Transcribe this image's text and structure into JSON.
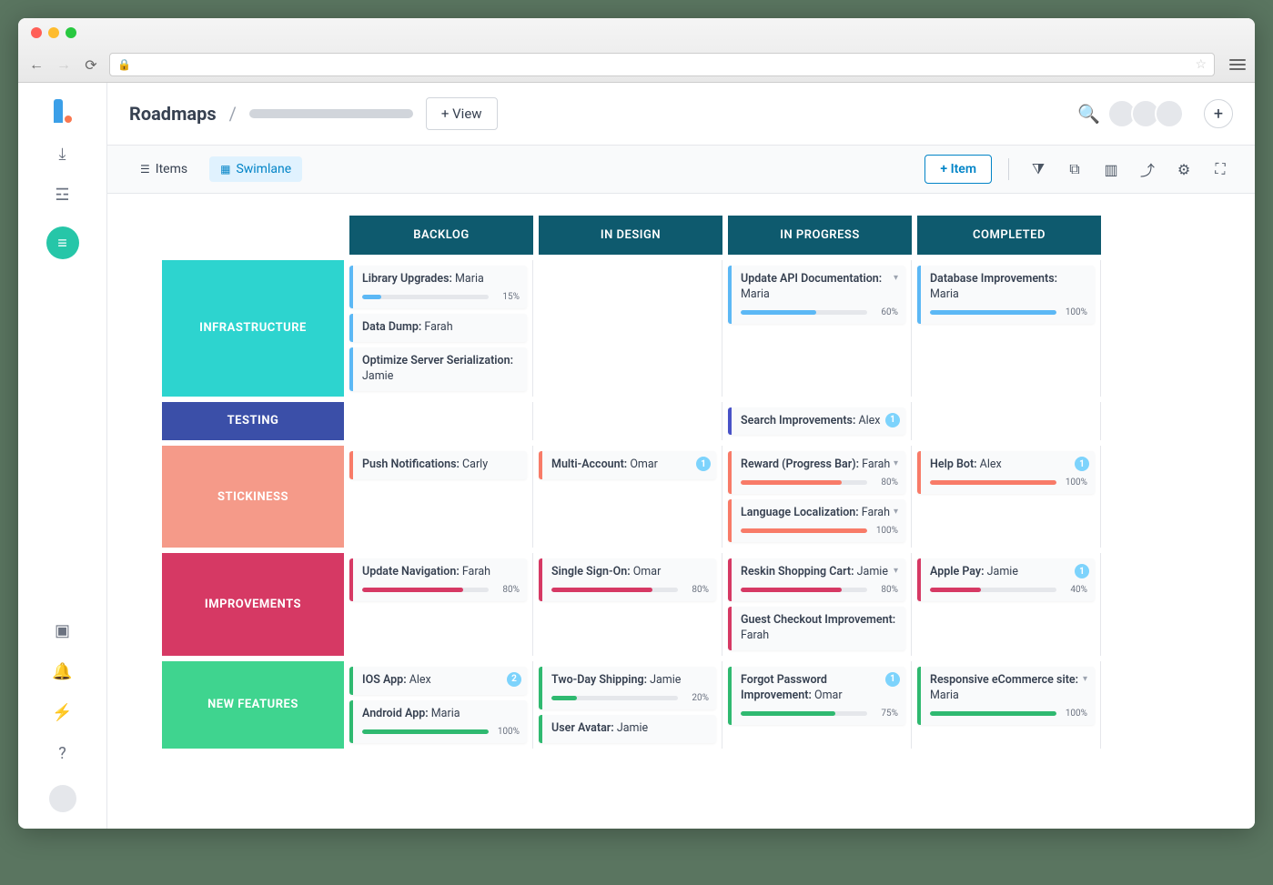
{
  "header": {
    "title": "Roadmaps",
    "viewBtn": "+  View",
    "addItemBtn": "+  Item"
  },
  "tabs": {
    "items": "Items",
    "swimlane": "Swimlane"
  },
  "columns": [
    "BACKLOG",
    "IN DESIGN",
    "IN PROGRESS",
    "COMPLETED"
  ],
  "laneColors": {
    "infrastructure": "#2dd4cf",
    "testing": "#3b4fa8",
    "stickiness": "#f59a89",
    "improvements": "#d63964",
    "newfeatures": "#3fd48f"
  },
  "cardColors": {
    "infrastructure": "#5cb8f5",
    "testing": "#4852c7",
    "stickiness": "#f87b68",
    "improvements": "#d63964",
    "newfeatures": "#2fb970"
  },
  "lanes": [
    {
      "key": "infrastructure",
      "label": "INFRASTRUCTURE",
      "cols": [
        [
          {
            "title": "Library Upgrades:",
            "assignee": "Maria",
            "progress": 15
          },
          {
            "title": "Data Dump:",
            "assignee": "Farah"
          },
          {
            "title": "Optimize Server Serialization:",
            "assignee": "Jamie"
          }
        ],
        [],
        [
          {
            "title": "Update API Documentation:",
            "assignee": "Maria",
            "progress": 60,
            "caret": true
          }
        ],
        [
          {
            "title": "Database Improvements:",
            "assignee": "Maria",
            "progress": 100
          }
        ]
      ]
    },
    {
      "key": "testing",
      "label": "TESTING",
      "cols": [
        [],
        [],
        [
          {
            "title": "Search Improvements:",
            "assignee": "Alex",
            "badge": 1
          }
        ],
        []
      ]
    },
    {
      "key": "stickiness",
      "label": "STICKINESS",
      "cols": [
        [
          {
            "title": "Push Notifications:",
            "assignee": "Carly"
          }
        ],
        [
          {
            "title": "Multi-Account:",
            "assignee": "Omar",
            "badge": 1
          }
        ],
        [
          {
            "title": "Reward (Progress Bar):",
            "assignee": "Farah",
            "progress": 80,
            "caret": true
          },
          {
            "title": "Language Localization:",
            "assignee": "Farah",
            "progress": 100,
            "caret": true
          }
        ],
        [
          {
            "title": "Help Bot:",
            "assignee": "Alex",
            "progress": 100,
            "badge": 1
          }
        ]
      ]
    },
    {
      "key": "improvements",
      "label": "IMPROVEMENTS",
      "cols": [
        [
          {
            "title": "Update Navigation:",
            "assignee": "Farah",
            "progress": 80
          }
        ],
        [
          {
            "title": "Single Sign-On:",
            "assignee": "Omar",
            "progress": 80
          }
        ],
        [
          {
            "title": "Reskin Shopping Cart:",
            "assignee": "Jamie",
            "progress": 80,
            "caret": true
          },
          {
            "title": "Guest Checkout Improvement:",
            "assignee": "Farah"
          }
        ],
        [
          {
            "title": "Apple Pay:",
            "assignee": "Jamie",
            "progress": 40,
            "badge": 1
          }
        ]
      ]
    },
    {
      "key": "newfeatures",
      "label": "NEW FEATURES",
      "cols": [
        [
          {
            "title": "IOS App:",
            "assignee": "Alex",
            "badge": 2
          },
          {
            "title": "Android App:",
            "assignee": "Maria",
            "progress": 100
          }
        ],
        [
          {
            "title": "Two-Day Shipping:",
            "assignee": "Jamie",
            "progress": 20
          },
          {
            "title": "User Avatar:",
            "assignee": "Jamie"
          }
        ],
        [
          {
            "title": "Forgot Password Improvement:",
            "assignee": "Omar",
            "progress": 75,
            "badge": 1
          }
        ],
        [
          {
            "title": "Responsive eCommerce site:",
            "assignee": "Maria",
            "progress": 100,
            "caret": true
          }
        ]
      ]
    }
  ]
}
